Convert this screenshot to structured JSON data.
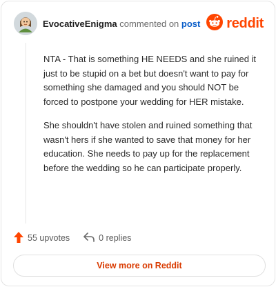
{
  "header": {
    "username": "EvocativeEnigma",
    "verb": "commented on",
    "post_link": "post",
    "brand": "reddit"
  },
  "comment": {
    "paragraphs": [
      "NTA - That is something HE NEEDS and she ruined it just to be stupid on a bet but doesn't want to pay for something she damaged and you should NOT be forced to postpone your wedding for HER mistake.",
      "She shouldn't have stolen and ruined something that wasn't hers if she wanted to save that money for her education. She needs to pay up for the replacement before the wedding so he can participate properly."
    ]
  },
  "footer": {
    "upvotes": "55 upvotes",
    "replies": "0 replies"
  },
  "view_more_label": "View more on Reddit",
  "colors": {
    "brand": "#ff4500",
    "link": "#0b5ec9",
    "view_more": "#d93a00"
  },
  "icons": [
    "avatar",
    "reddit-logo-icon",
    "upvote-arrow-icon",
    "reply-icon"
  ]
}
